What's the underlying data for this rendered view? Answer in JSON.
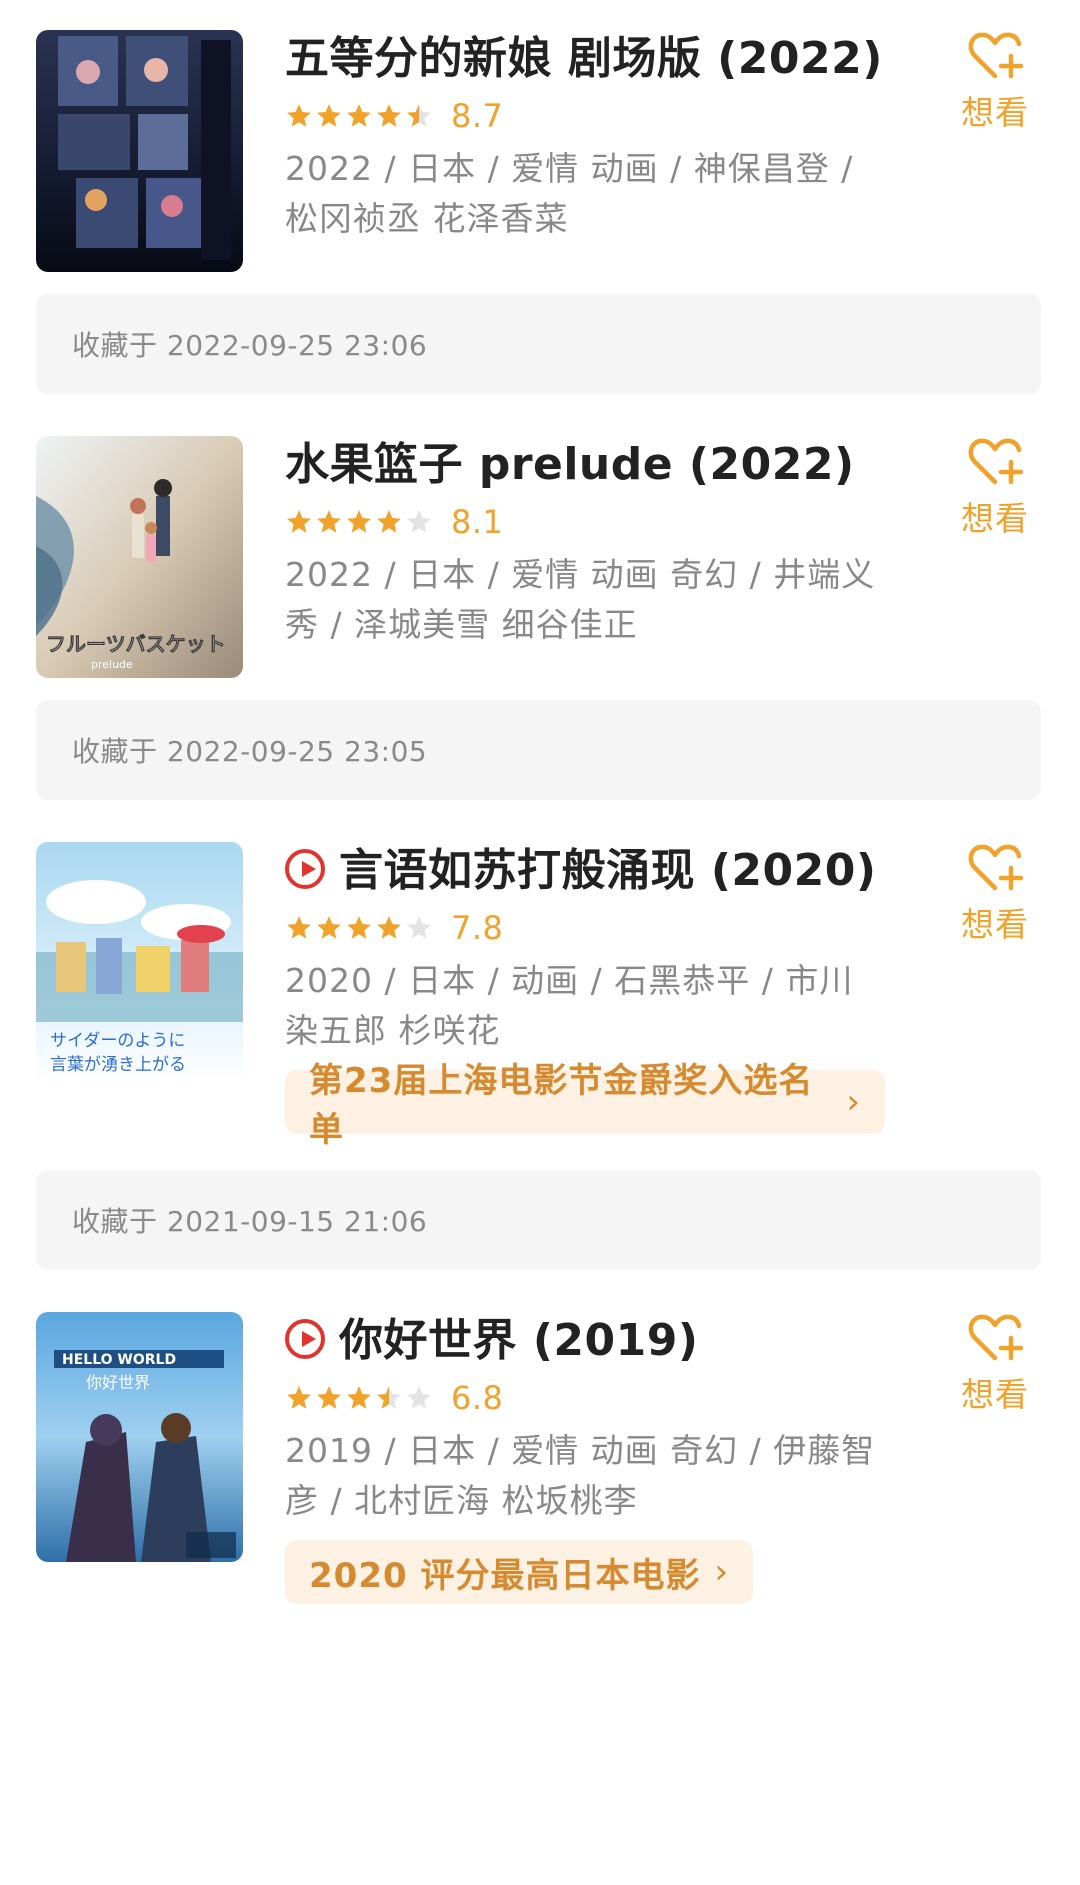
{
  "accent_color": "#f0a22a",
  "play_icon_color": "#e2342c",
  "want_label": "想看",
  "movies": [
    {
      "title": "五等分的新娘 剧场版 (2022)",
      "has_play": false,
      "rating": 4.5,
      "score": "8.7",
      "meta": "2022 / 日本 / 爱情 动画 / 神保昌登 / 松冈祯丞 花泽香菜",
      "award": "",
      "saved": "收藏于 2022-09-25 23:06",
      "poster_icon": "poster-anime-night-window"
    },
    {
      "title": "水果篮子 prelude (2022)",
      "has_play": false,
      "rating": 4,
      "score": "8.1",
      "meta": "2022 / 日本 / 爱情 动画 奇幻 / 井端义秀 / 泽城美雪 细谷佳正",
      "award": "",
      "saved": "收藏于 2022-09-25 23:05",
      "poster_icon": "poster-anime-beach"
    },
    {
      "title": "言语如苏打般涌现 (2020)",
      "has_play": true,
      "rating": 4,
      "score": "7.8",
      "meta": "2020 / 日本 / 动画 / 石黑恭平 / 市川染五郎 杉咲花",
      "award": "第23届上海电影节金爵奖入选名单",
      "award_chevron": "›",
      "saved": "收藏于 2021-09-15 21:06",
      "poster_icon": "poster-anime-town-sky"
    },
    {
      "title": "你好世界 (2019)",
      "has_play": true,
      "rating": 3.5,
      "score": "6.8",
      "meta": "2019 / 日本 / 爱情 动画 奇幻 / 伊藤智彦 / 北村匠海 松坂桃李",
      "award": "2020 评分最高日本电影",
      "award_chevron": "›",
      "saved": "",
      "poster_icon": "poster-anime-hello-world"
    }
  ]
}
